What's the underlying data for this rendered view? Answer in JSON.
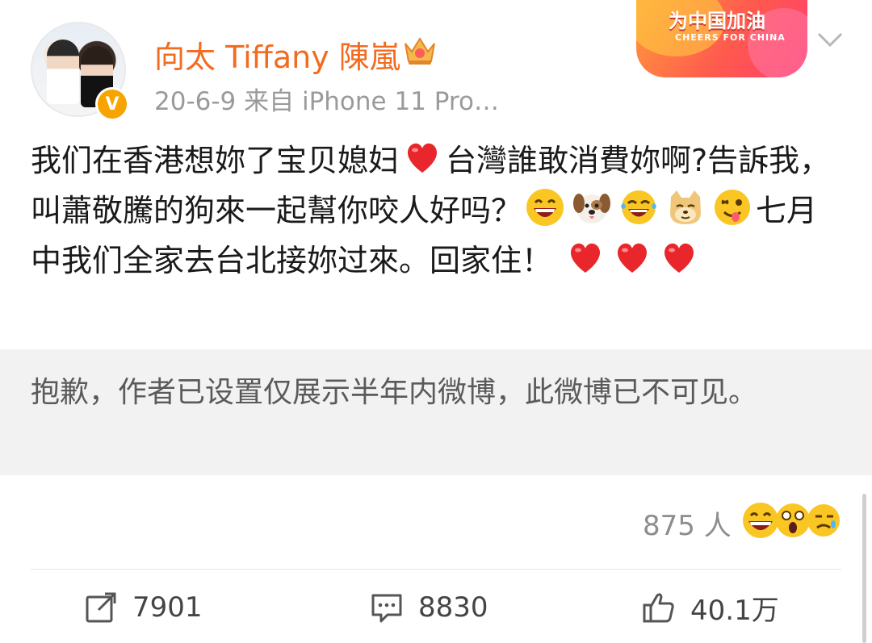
{
  "post": {
    "author": "向太 Tiffany 陳嵐",
    "meta": "20-6-9  来自 iPhone 11 Pro…",
    "verified_badge": "V",
    "text": {
      "seg1": "我们在香港想妳了宝贝媳妇",
      "seg2": "台灣誰敢消費妳啊?告訴我，叫蕭敬騰的狗來一起幫你咬人好吗？",
      "seg3": "七月中我们全家去台北接妳过來。回家住！"
    },
    "emoji": {
      "heart": "heart-icon",
      "grin": "grin-face-icon",
      "dog": "dog-face-icon",
      "tears_of_joy": "laughing-tears-icon",
      "doge": "doge-icon",
      "wink_tongue": "wink-tongue-icon"
    }
  },
  "banner": {
    "title": "为中国加油",
    "subtitle": "CHEERS FOR CHINA"
  },
  "notice": {
    "text": "抱歉，作者已设置仅展示半年内微博，此微博已不可见。"
  },
  "reactions": {
    "count": "875 人"
  },
  "actions": {
    "repost": "7901",
    "comment": "8830",
    "like": "40.1万"
  },
  "colors": {
    "username": "#f26b21",
    "meta": "#9a9a9a",
    "notice_bg": "#f2f2f2",
    "verified": "#f7a400"
  }
}
